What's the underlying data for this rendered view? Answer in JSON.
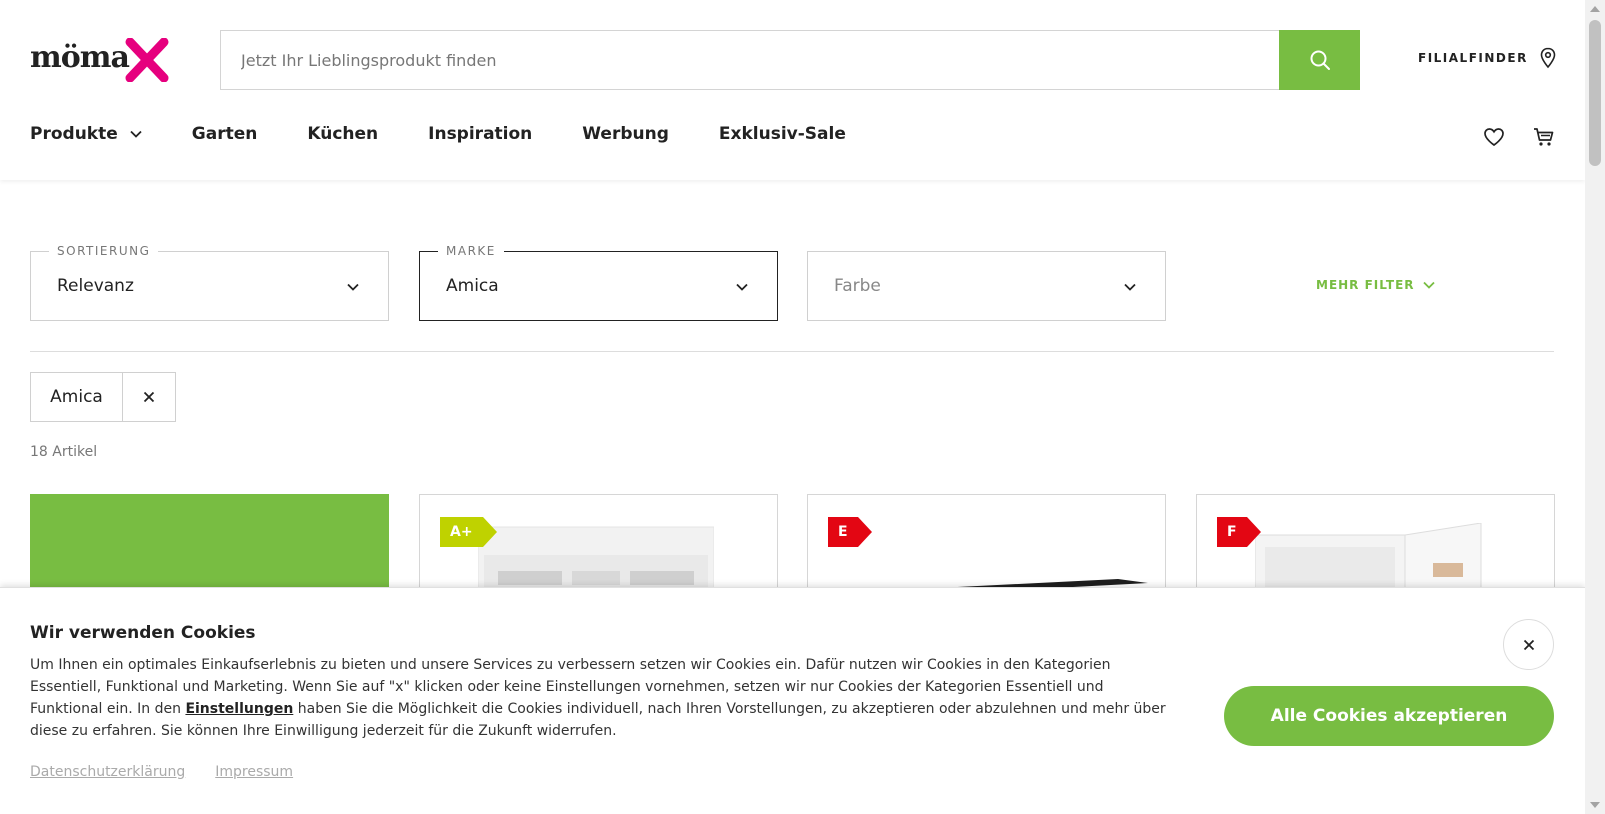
{
  "brand": {
    "logo_text": "möma",
    "accent": "#e6007e",
    "green": "#78bd42"
  },
  "search": {
    "placeholder": "Jetzt Ihr Lieblingsprodukt finden",
    "value": ""
  },
  "header": {
    "filialfinder": "FILIALFINDER"
  },
  "nav": {
    "items": [
      {
        "label": "Produkte"
      },
      {
        "label": "Garten"
      },
      {
        "label": "Küchen"
      },
      {
        "label": "Inspiration"
      },
      {
        "label": "Werbung"
      },
      {
        "label": "Exklusiv-Sale"
      }
    ]
  },
  "filters": {
    "sort": {
      "legend": "SORTIERUNG",
      "value": "Relevanz"
    },
    "brand": {
      "legend": "MARKE",
      "value": "Amica"
    },
    "color": {
      "placeholder": "Farbe"
    },
    "more": "MEHR FILTER"
  },
  "active_filter": {
    "label": "Amica"
  },
  "results": {
    "count": "18 Artikel"
  },
  "products": [
    {
      "badge": "",
      "badge_color": ""
    },
    {
      "badge": "A+",
      "badge_color": "#bfd200"
    },
    {
      "badge": "E",
      "badge_color": "#e30613"
    },
    {
      "badge": "F",
      "badge_color": "#e30613"
    }
  ],
  "cookie": {
    "title": "Wir verwenden Cookies",
    "text_before": "Um Ihnen ein optimales Einkaufserlebnis zu bieten und unsere Services zu verbessern setzen wir Cookies ein. Dafür nutzen wir Cookies in den Kategorien Essentiell, Funktional und Marketing. Wenn Sie auf \"x\" klicken oder keine Einstellungen vornehmen, setzen wir nur Cookies der Kategorien Essentiell und Funktional ein. In den",
    "link_settings": "Einstellungen",
    "text_after": "haben Sie die Möglichkeit die Cookies individuell, nach Ihren Vorstellungen, zu akzeptieren oder abzulehnen und mehr über diese zu erfahren. Sie können Ihre Einwilligung jederzeit für die Zukunft widerrufen.",
    "privacy": "Datenschutzerklärung",
    "imprint": "Impressum",
    "accept": "Alle Cookies akzeptieren"
  }
}
